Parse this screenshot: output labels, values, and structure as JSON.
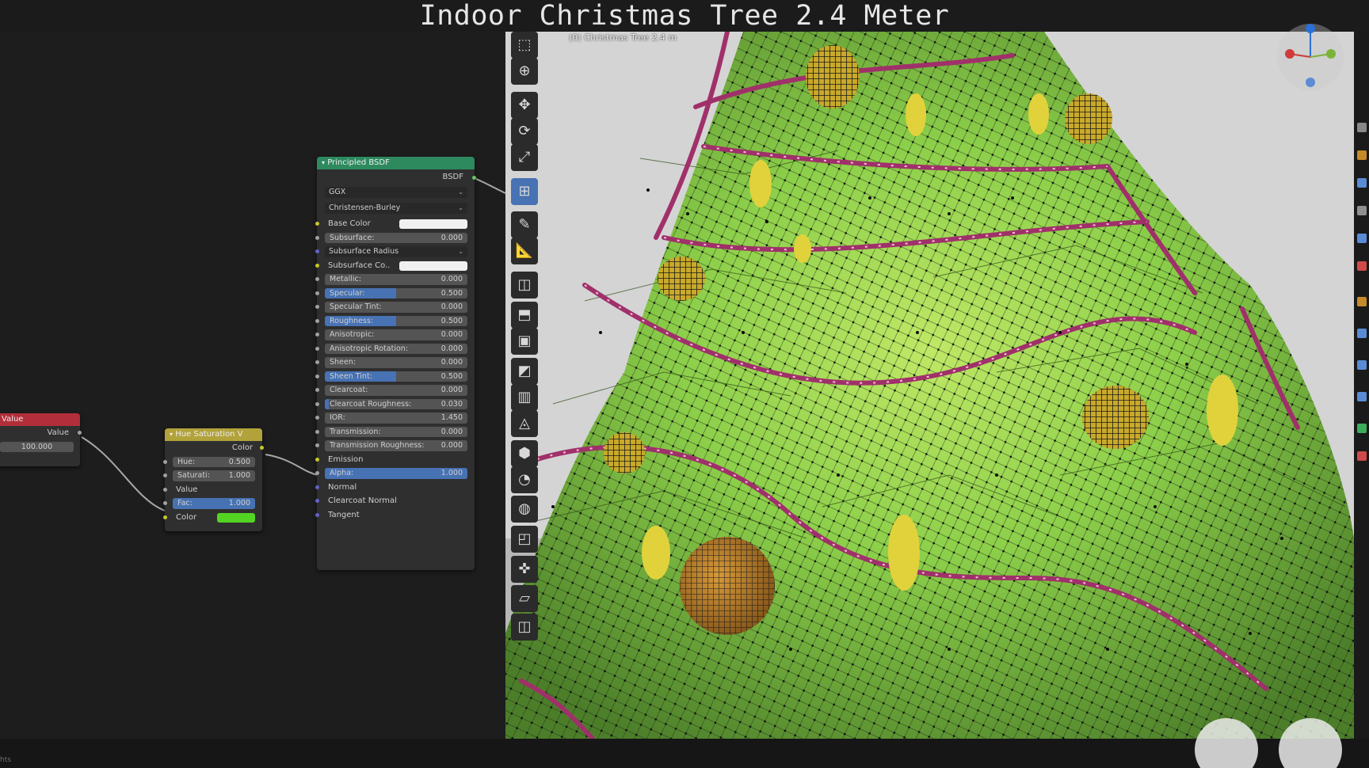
{
  "title": "Indoor Christmas Tree 2.4 Meter",
  "viewport": {
    "object_label": "(0) Christmas Tree 2.4 m",
    "tools": [
      "select-box-icon",
      "cursor-icon",
      "move-icon",
      "rotate-icon",
      "scale-icon",
      "transform-icon",
      "annotate-icon",
      "measure-icon",
      "add-cube-icon",
      "extrude-region-icon",
      "inset-faces-icon",
      "bevel-icon",
      "loop-cut-icon",
      "knife-icon",
      "poly-build-icon",
      "spin-icon",
      "smooth-icon",
      "edge-slide-icon",
      "shrink-fatten-icon",
      "shear-icon",
      "rip-region-icon"
    ],
    "active_tool_index": 5
  },
  "status": {
    "left_text": "hts"
  },
  "nodes": {
    "value": {
      "header": "Value",
      "output_label": "Value",
      "value": "100.000",
      "header_color": "#b22e3a"
    },
    "hue_sat": {
      "header": "Hue Saturation V",
      "header_color": "#b2a23a",
      "output_label": "Color",
      "hue_label": "Hue:",
      "hue_value": "0.500",
      "sat_label": "Saturati:",
      "sat_value": "1.000",
      "value_label": "Value",
      "fac_label": "Fac:",
      "fac_value": "1.000",
      "fac_fill": 1.0,
      "color_label": "Color",
      "color_swatch": "#54d422"
    },
    "bsdf": {
      "header": "Principled BSDF",
      "header_color": "#2c8a5e",
      "output_label": "BSDF",
      "distribution": "GGX",
      "subsurface_method": "Christensen-Burley",
      "rows": [
        {
          "label": "Base Color",
          "type": "color",
          "color": "#f0f0f0",
          "socket": "yellow"
        },
        {
          "label": "Subsurface:",
          "type": "field",
          "value": "0.000",
          "fill": 0,
          "socket": "gray"
        },
        {
          "label": "Subsurface Radius",
          "type": "dropdown",
          "socket": "purple"
        },
        {
          "label": "Subsurface Co..",
          "type": "color",
          "color": "#f0f0f0",
          "socket": "yellow"
        },
        {
          "label": "Metallic:",
          "type": "field",
          "value": "0.000",
          "fill": 0,
          "socket": "gray"
        },
        {
          "label": "Specular:",
          "type": "field",
          "value": "0.500",
          "fill": 0.5,
          "socket": "gray"
        },
        {
          "label": "Specular Tint:",
          "type": "field",
          "value": "0.000",
          "fill": 0,
          "socket": "gray"
        },
        {
          "label": "Roughness:",
          "type": "field",
          "value": "0.500",
          "fill": 0.5,
          "socket": "gray"
        },
        {
          "label": "Anisotropic:",
          "type": "field",
          "value": "0.000",
          "fill": 0,
          "socket": "gray"
        },
        {
          "label": "Anisotropic Rotation:",
          "type": "field",
          "value": "0.000",
          "fill": 0,
          "socket": "gray"
        },
        {
          "label": "Sheen:",
          "type": "field",
          "value": "0.000",
          "fill": 0,
          "socket": "gray"
        },
        {
          "label": "Sheen Tint:",
          "type": "field",
          "value": "0.500",
          "fill": 0.5,
          "socket": "gray"
        },
        {
          "label": "Clearcoat:",
          "type": "field",
          "value": "0.000",
          "fill": 0,
          "socket": "gray"
        },
        {
          "label": "Clearcoat Roughness:",
          "type": "field",
          "value": "0.030",
          "fill": 0.03,
          "socket": "gray"
        },
        {
          "label": "IOR:",
          "type": "field",
          "value": "1.450",
          "fill": 0,
          "socket": "gray"
        },
        {
          "label": "Transmission:",
          "type": "field",
          "value": "0.000",
          "fill": 0,
          "socket": "gray"
        },
        {
          "label": "Transmission Roughness:",
          "type": "field",
          "value": "0.000",
          "fill": 0,
          "socket": "gray"
        },
        {
          "label": "Emission",
          "type": "socket",
          "socket": "yellow"
        },
        {
          "label": "Alpha:",
          "type": "field",
          "value": "1.000",
          "fill": 1.0,
          "socket": "gray"
        },
        {
          "label": "Normal",
          "type": "socket",
          "socket": "purple"
        },
        {
          "label": "Clearcoat Normal",
          "type": "socket",
          "socket": "purple"
        },
        {
          "label": "Tangent",
          "type": "socket",
          "socket": "purple"
        }
      ]
    }
  },
  "colors": {
    "accent": "#4772b3",
    "tree_green": "#8ccf4a",
    "garland": "#a0306a",
    "ornament_yellow": "#d8c534"
  }
}
